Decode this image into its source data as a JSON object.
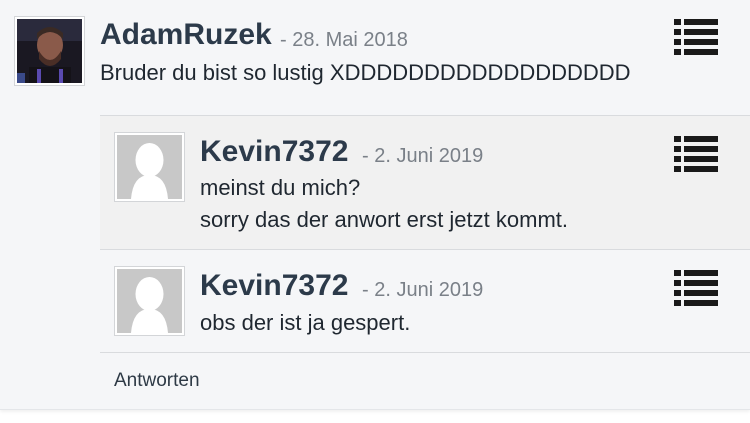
{
  "comment": {
    "author": "AdamRuzek",
    "date": "- 28. Mai 2018",
    "text": "Bruder du bist so lustig XDDDDDDDDDDDDDDDDDD"
  },
  "replies": [
    {
      "author": "Kevin7372",
      "date": "- 2. Juni 2019",
      "lines": [
        "meinst du mich?",
        "sorry das der anwort erst jetzt kommt."
      ]
    },
    {
      "author": "Kevin7372",
      "date": "- 2. Juni 2019",
      "lines": [
        "obs der ist ja gespert."
      ]
    }
  ],
  "reply_label": "Antworten",
  "icons": {
    "menu": "list-menu-icon",
    "default_avatar": "default-user-avatar-icon"
  },
  "colors": {
    "background": "#f5f6f8",
    "reply_highlight": "#f1f1f1",
    "author": "#2c3a4a",
    "date": "#7a8088",
    "menu_icon": "#1a1a1a"
  }
}
